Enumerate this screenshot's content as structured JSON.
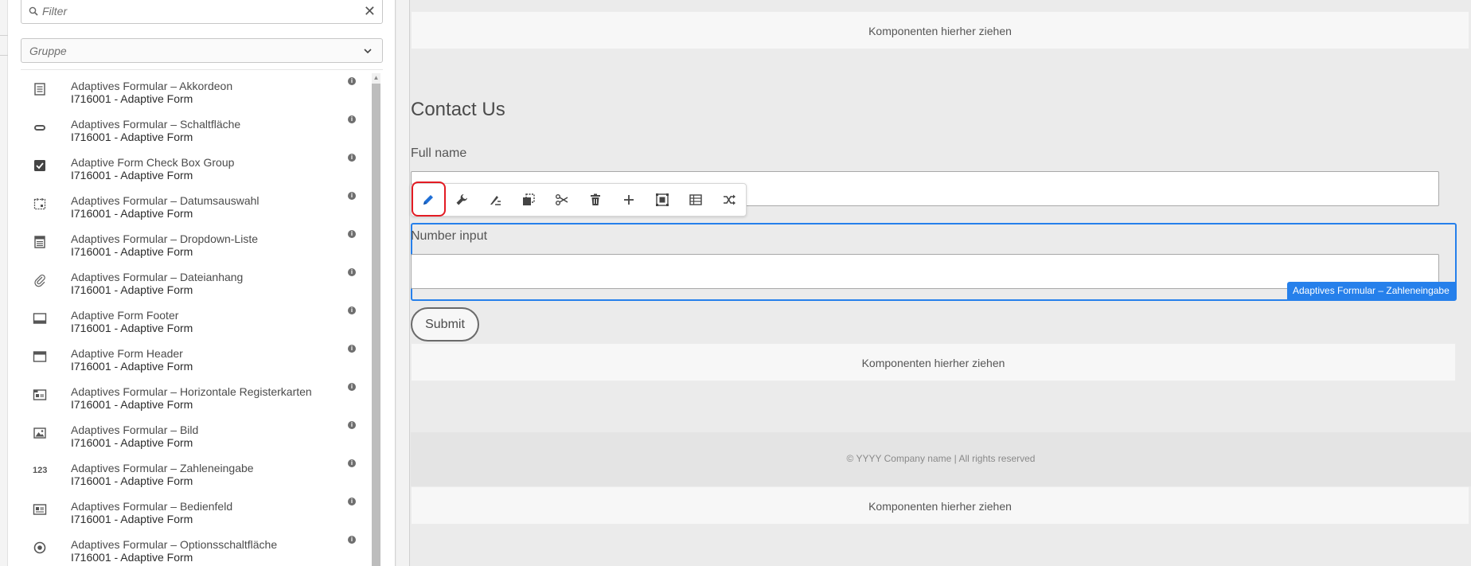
{
  "sidebar": {
    "filter_placeholder": "Filter",
    "clear_label": "✕",
    "group_placeholder": "Gruppe",
    "components": [
      {
        "title": "Adaptives Formular – Akkordeon",
        "subtitle": "I716001 - Adaptive Form",
        "icon": "accordion-icon"
      },
      {
        "title": "Adaptives Formular – Schaltfläche",
        "subtitle": "I716001 - Adaptive Form",
        "icon": "button-icon"
      },
      {
        "title": "Adaptive Form Check Box Group",
        "subtitle": "I716001 - Adaptive Form",
        "icon": "checkbox-icon"
      },
      {
        "title": "Adaptives Formular – Datumsauswahl",
        "subtitle": "I716001 - Adaptive Form",
        "icon": "calendar-icon"
      },
      {
        "title": "Adaptives Formular – Dropdown-Liste",
        "subtitle": "I716001 - Adaptive Form",
        "icon": "dropdown-list-icon"
      },
      {
        "title": "Adaptives Formular – Dateianhang",
        "subtitle": "I716001 - Adaptive Form",
        "icon": "paperclip-icon"
      },
      {
        "title": "Adaptive Form Footer",
        "subtitle": "I716001 - Adaptive Form",
        "icon": "footer-icon"
      },
      {
        "title": "Adaptive Form Header",
        "subtitle": "I716001 - Adaptive Form",
        "icon": "header-icon"
      },
      {
        "title": "Adaptives Formular – Horizontale Registerkarten",
        "subtitle": "I716001 - Adaptive Form",
        "icon": "tabs-icon"
      },
      {
        "title": "Adaptives Formular – Bild",
        "subtitle": "I716001 - Adaptive Form",
        "icon": "image-icon"
      },
      {
        "title": "Adaptives Formular – Zahleneingabe",
        "subtitle": "I716001 - Adaptive Form",
        "icon": "number-icon",
        "glyph": "123"
      },
      {
        "title": "Adaptives Formular – Bedienfeld",
        "subtitle": "I716001 - Adaptive Form",
        "icon": "panel-icon"
      },
      {
        "title": "Adaptives Formular – Optionsschaltfläche",
        "subtitle": "I716001 - Adaptive Form",
        "icon": "radio-icon"
      }
    ],
    "info_glyph": "i"
  },
  "canvas": {
    "dropzone_label": "Komponenten hierher ziehen",
    "form_title": "Contact Us",
    "full_name_label": "Full name",
    "number_label": "Number input",
    "selected_component_tag": "Adaptives Formular – Zahleneingabe",
    "submit_label": "Submit",
    "footer_text": "© YYYY Company name | All rights reserved"
  },
  "toolbar": {
    "buttons": [
      "pencil-icon",
      "wrench-icon",
      "style-icon",
      "copy-icon",
      "scissors-icon",
      "trash-icon",
      "plus-icon",
      "group-icon",
      "table-icon",
      "shuffle-icon"
    ]
  },
  "colors": {
    "selection": "#2680eb",
    "highlight": "#e31b23"
  }
}
